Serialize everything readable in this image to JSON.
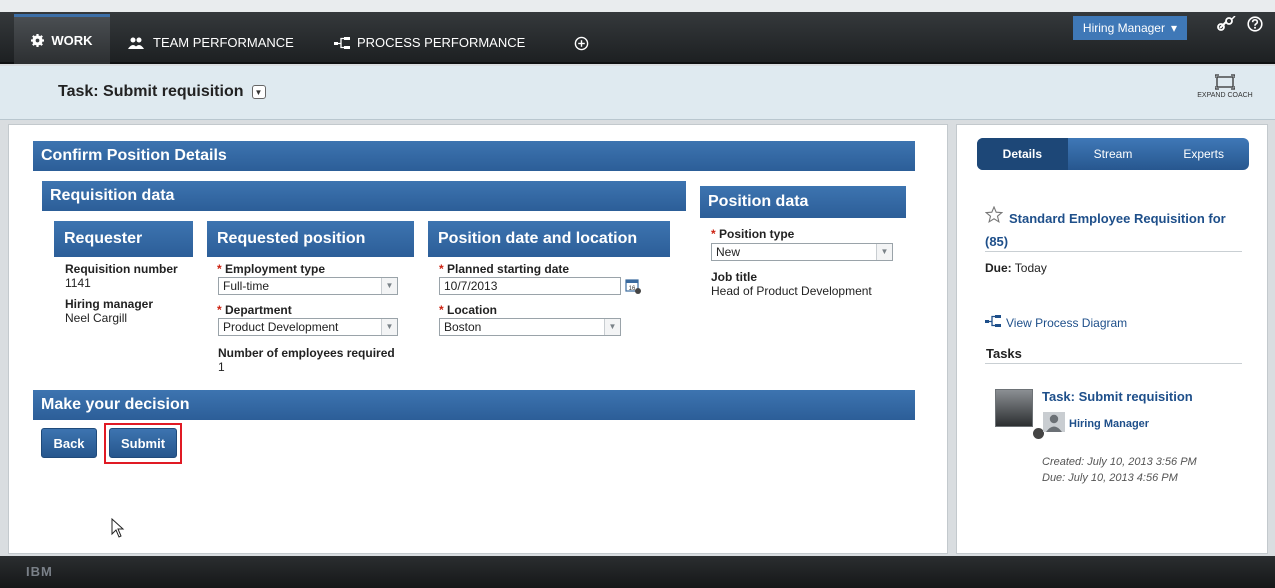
{
  "nav": {
    "tabs": [
      {
        "label": "WORK",
        "icon": "gear-icon"
      },
      {
        "label": "TEAM PERFORMANCE",
        "icon": "team-icon"
      },
      {
        "label": "PROCESS PERFORMANCE",
        "icon": "process-icon"
      }
    ],
    "add_icon": "plus-circle-icon",
    "user_menu": "Hiring Manager",
    "link_icon": "link-icon",
    "help_icon": "help-icon"
  },
  "task_header": {
    "title": "Task: Submit requisition",
    "expand_label": "EXPAND COACH"
  },
  "form": {
    "section_title": "Confirm Position Details",
    "requisition_title": "Requisition data",
    "requester": {
      "title": "Requester",
      "requisition_number_label": "Requisition number",
      "requisition_number": "1141",
      "hiring_manager_label": "Hiring manager",
      "hiring_manager": "Neel Cargill"
    },
    "requested_position": {
      "title": "Requested position",
      "employment_type_label": "Employment type",
      "employment_type": "Full-time",
      "department_label": "Department",
      "department": "Product Development",
      "num_employees_label": "Number of employees required",
      "num_employees": "1"
    },
    "date_location": {
      "title": "Position date and location",
      "start_date_label": "Planned starting date",
      "start_date": "10/7/2013",
      "location_label": "Location",
      "location": "Boston"
    },
    "position_data": {
      "title": "Position data",
      "position_type_label": "Position type",
      "position_type": "New",
      "job_title_label": "Job title",
      "job_title": "Head of Product Development"
    },
    "required_mark": "*",
    "decision_title": "Make your decision",
    "back_label": "Back",
    "submit_label": "Submit"
  },
  "side": {
    "tabs": [
      "Details",
      "Stream",
      "Experts"
    ],
    "active_tab": "Details",
    "requisition_title": "Standard Employee Requisition for (85)",
    "due_label": "Due:",
    "due_value": "Today",
    "view_diagram": "View Process Diagram",
    "tasks_heading": "Tasks",
    "task": {
      "title": "Task: Submit requisition",
      "assignee": "Hiring Manager",
      "created": "Created: July 10, 2013 3:56 PM",
      "due": "Due: July 10, 2013 4:56 PM"
    }
  },
  "footer": {
    "brand": "IBM"
  },
  "colors": {
    "accent": "#3d74b0",
    "highlight": "#e01a24",
    "link": "#1e4f8a"
  }
}
